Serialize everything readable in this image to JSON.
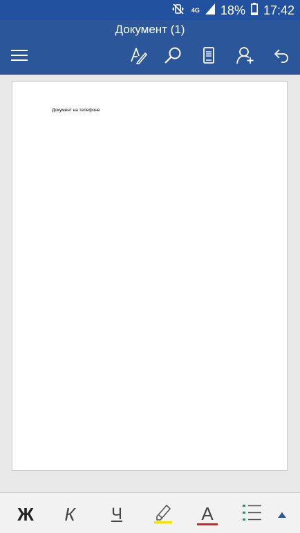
{
  "status_bar": {
    "network": "4G",
    "battery": "18%",
    "time": "17:42",
    "icons": [
      "mute-vibrate-icon",
      "signal-icon",
      "battery-icon"
    ]
  },
  "app_bar": {
    "title": "Документ (1)",
    "toolbar": [
      "menu-icon",
      "edit-pen-icon",
      "search-icon",
      "mobile-view-icon",
      "share-person-icon",
      "undo-icon"
    ]
  },
  "document": {
    "text": "Документ на телефоне"
  },
  "format_bar": {
    "bold": "Ж",
    "italic": "К",
    "underline": "Ч",
    "font_color": "A",
    "highlight_color": "#f2e600",
    "font_color_value": "#e21d1d"
  },
  "colors": {
    "accent": "#2b579a",
    "status_bar": "#21519f"
  }
}
